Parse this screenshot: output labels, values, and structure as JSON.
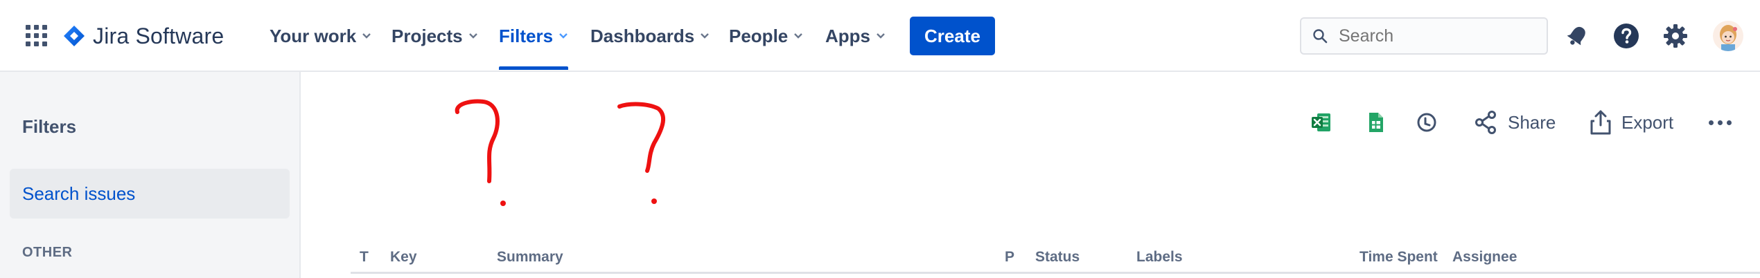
{
  "topbar": {
    "app_name": "Jira Software",
    "nav": [
      {
        "label": "Your work"
      },
      {
        "label": "Projects"
      },
      {
        "label": "Filters"
      },
      {
        "label": "Dashboards"
      },
      {
        "label": "People"
      },
      {
        "label": "Apps"
      }
    ],
    "active_nav": "Filters",
    "create_label": "Create",
    "search_placeholder": "Search",
    "accent_color": "#0052cc"
  },
  "sidebar": {
    "title": "Filters",
    "selected_item": "Search issues",
    "section_label": "OTHER"
  },
  "toolbar": {
    "icons": [
      "excel-icon",
      "google-sheets-icon",
      "watch-icon"
    ],
    "share_label": "Share",
    "export_label": "Export"
  },
  "table": {
    "columns": [
      "T",
      "Key",
      "Summary",
      "P",
      "Status",
      "Labels",
      "Time Spent",
      "Assignee"
    ]
  },
  "annotations": {
    "marks": [
      "?",
      "?"
    ],
    "color": "#ee1111"
  }
}
